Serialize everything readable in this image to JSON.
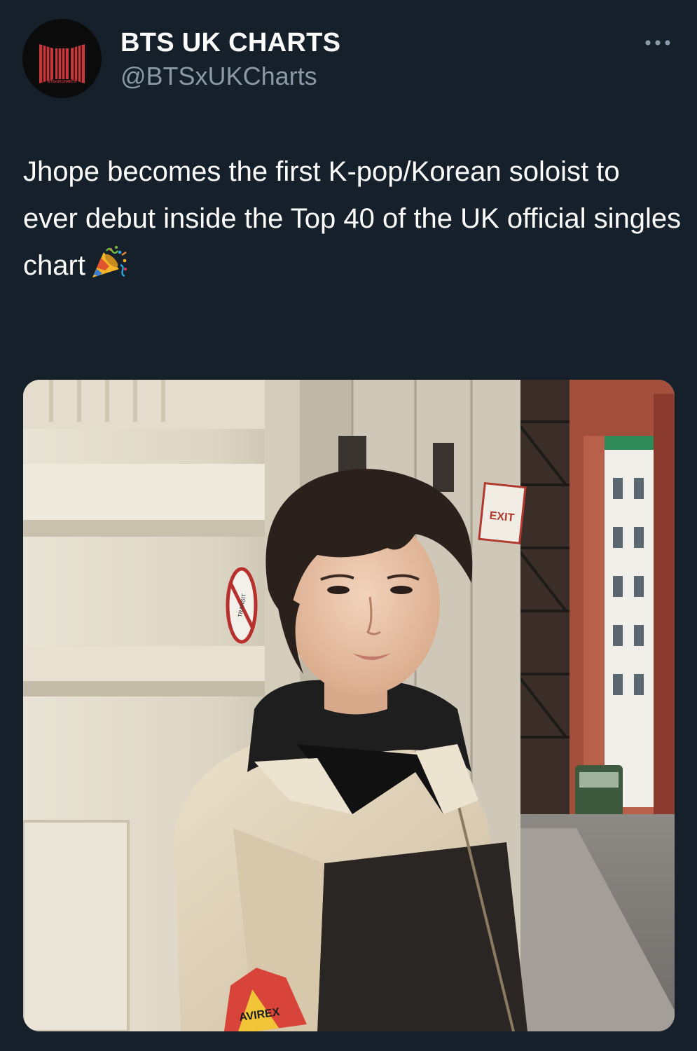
{
  "tweet": {
    "author_name": "BTS UK CHARTS",
    "author_handle": "@BTSxUKCharts",
    "avatar_text": "BTSxUKCHARTS",
    "text": "Jhope becomes the first K-pop/Korean soloist to ever debut inside the Top 40 of the UK official singles chart",
    "emoji": "party-popper-icon",
    "more_icon": "more-options-icon"
  },
  "photo": {
    "sign_text": "EXIT",
    "sticker_text": "TRANSIT",
    "patch_text": "AVIREX"
  },
  "colors": {
    "background": "#15202b",
    "text_primary": "#ffffff",
    "text_secondary": "#8b98a5",
    "brand_red": "#c8383b"
  }
}
